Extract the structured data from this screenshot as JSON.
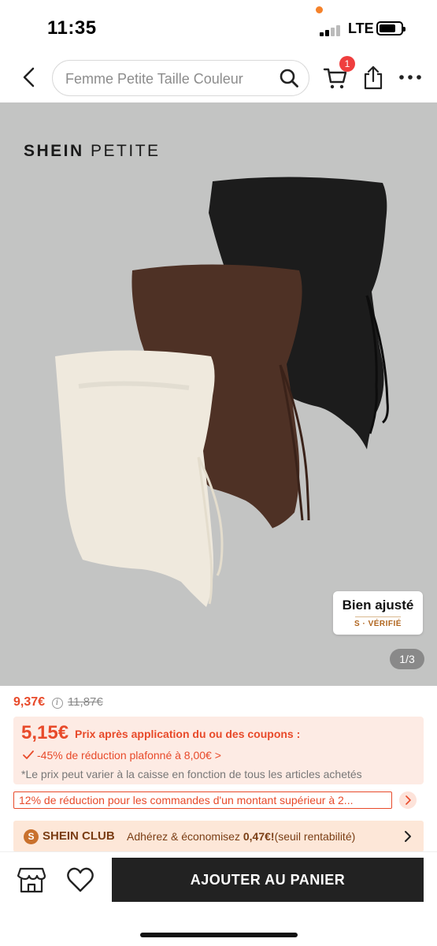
{
  "status_bar": {
    "time": "11:35",
    "network": "LTE"
  },
  "nav": {
    "search_placeholder": "Femme Petite Taille Couleur",
    "cart_count": "1"
  },
  "product": {
    "brand_bold": "SHEIN",
    "brand_light": "PETITE",
    "fit_badge_title": "Bien ajusté",
    "fit_badge_sub": "S · VÉRIFIÉ",
    "image_index": "1/3",
    "garment_colors": [
      "#efe9dd",
      "#4e3125",
      "#1c1c1c"
    ]
  },
  "pricing": {
    "current_price": "9,37€",
    "original_price": "11,87€",
    "coupon_price": "5,15€",
    "coupon_label": "Prix après application du ou des coupons :",
    "coupon_discount": "-45% de réduction plafonné à 8,00€ >",
    "coupon_note": "*Le prix peut varier à la caisse en fonction de tous les articles achetés",
    "promo_text": "12% de réduction pour les commandes d'un montant supérieur à 2..."
  },
  "club": {
    "icon_letter": "S",
    "name": "SHEIN CLUB",
    "text_prefix": "Adhérez & économisez ",
    "text_amount": "0,47€!",
    "text_suffix": "(seuil rentabilité)"
  },
  "actions": {
    "add_to_cart": "AJOUTER AU PANIER"
  },
  "colors": {
    "accent_red": "#e84a2a",
    "button_dark": "#222222",
    "club_brown": "#7a3d14"
  }
}
